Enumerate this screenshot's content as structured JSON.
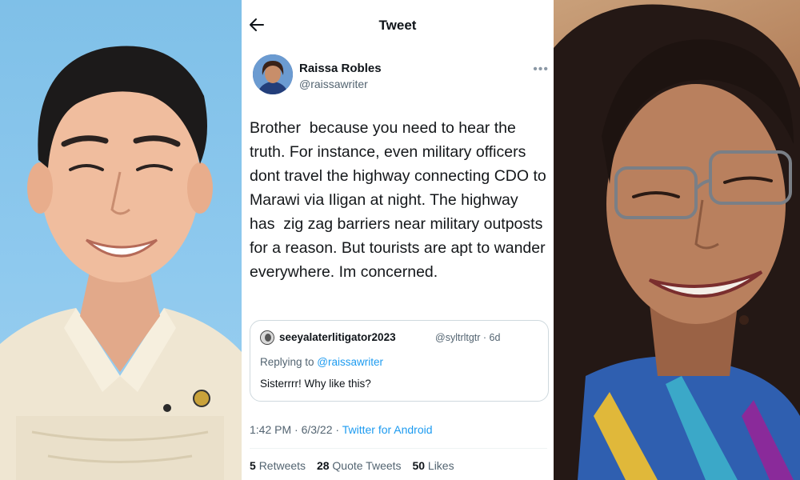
{
  "header": {
    "title": "Tweet"
  },
  "tweet": {
    "author_name": "Raissa Robles",
    "author_handle": "@raissawriter",
    "text": "Brother  because you need to hear the truth. For instance, even military officers dont travel the highway connecting CDO to  Marawi via Iligan at night. The highway has  zig zag barriers near military outposts for a reason. But tourists are apt to wander everywhere. Im concerned.",
    "timestamp": "1:42 PM · 6/3/22 · ",
    "source": "Twitter for Android"
  },
  "quoted_tweet": {
    "author_name": "seeyalaterlitigator2023",
    "meta": "@syltrltgtr · 6d",
    "replying_to_label": "Replying to ",
    "replying_to_handle": "@raissawriter",
    "text": "Sisterrrr! Why like this?"
  },
  "stats": {
    "retweets_count": "5",
    "retweets_label": "Retweets",
    "quotes_count": "28",
    "quotes_label": "Quote Tweets",
    "likes_count": "50",
    "likes_label": "Likes"
  },
  "colors": {
    "accent": "#1d9bf0",
    "text_primary": "#0f1419",
    "text_secondary": "#536471",
    "border": "#cfd9de"
  },
  "icons": {
    "back": "arrow-left-icon",
    "more": "more-horizontal-icon"
  }
}
